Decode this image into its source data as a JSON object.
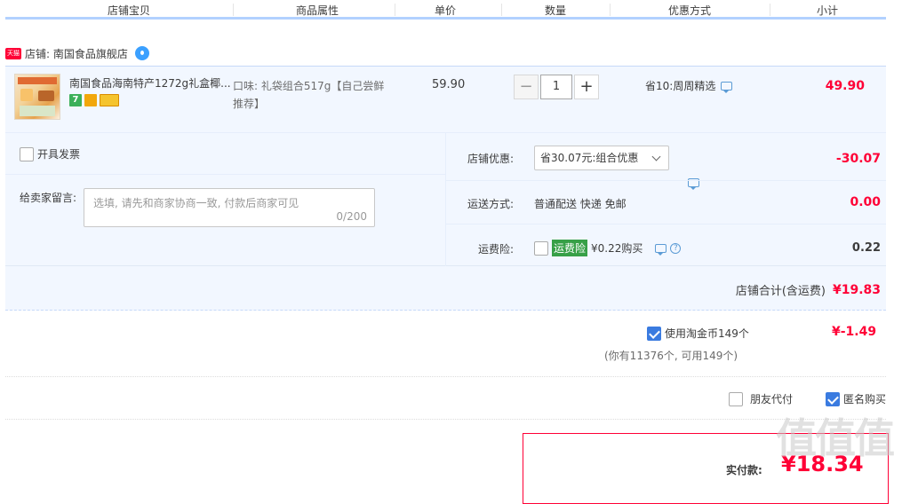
{
  "header": {
    "columns": [
      "店铺宝贝",
      "商品属性",
      "单价",
      "数量",
      "优惠方式",
      "小计"
    ]
  },
  "shop": {
    "badge": "天猫",
    "label": "店铺: 南国食品旗舰店"
  },
  "item": {
    "title": "南国食品海南特产1272g礼盒椰...",
    "service_badge": "7",
    "attr": "口味: 礼袋组合517g【自己尝鲜推荐】",
    "price": "59.90",
    "quantity": "1",
    "minus": "−",
    "plus": "+",
    "promo": "省10:周周精选",
    "subtotal": "49.90"
  },
  "invoice": {
    "label": "开具发票"
  },
  "memo": {
    "label": "给卖家留言:",
    "placeholder": "选填, 请先和商家协商一致, 付款后商家可见",
    "counter": "0/200"
  },
  "shop_discount": {
    "label": "店铺优惠:",
    "selected": "省30.07元:组合优惠",
    "value": "-30.07"
  },
  "shipping": {
    "label": "运送方式:",
    "method": "普通配送 快递 免邮",
    "value": "0.00"
  },
  "insurance": {
    "label": "运费险:",
    "tag": "运费险",
    "desc": "¥0.22购买",
    "help": "?",
    "value": "0.22"
  },
  "shop_total": {
    "label": "店铺合计(含运费)",
    "value": "¥19.83"
  },
  "coins": {
    "label": "使用淘金币149个",
    "note": "(你有11376个, 可用149个)",
    "value": "¥-1.49"
  },
  "options": {
    "friend_pay": "朋友代付",
    "anonymous": "匿名购买"
  },
  "pay": {
    "label": "实付款:",
    "value": "¥18.34"
  },
  "watermark": "值值值",
  "colors": {
    "accent_red": "#ff0036",
    "row_bg": "#f2f7ff",
    "header_line": "#b2d1ff",
    "check_blue": "#3a7be0"
  }
}
